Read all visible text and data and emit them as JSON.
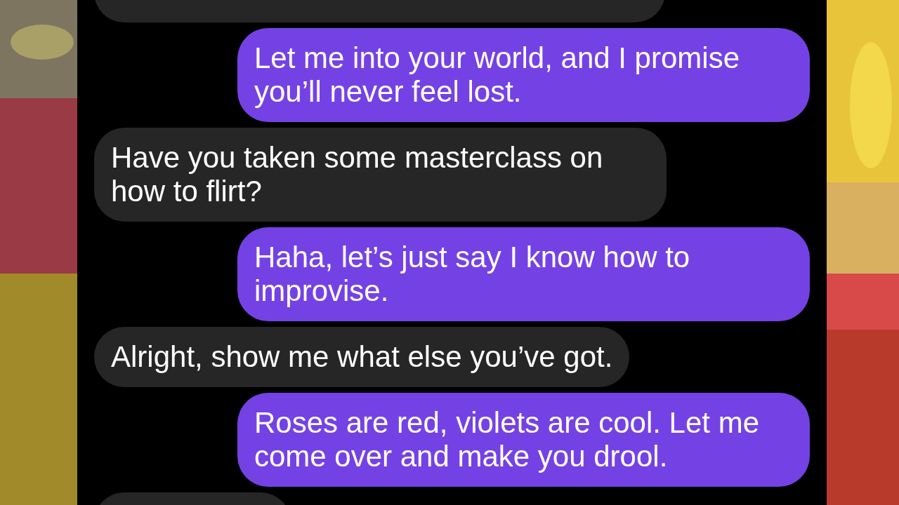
{
  "messages": [
    {
      "kind": "incoming"
    },
    {
      "kind": "outgoing",
      "text": "Let me into your world, and I promise you’ll never feel lost."
    },
    {
      "kind": "incoming",
      "text": "Have you taken some masterclass on how to flirt?"
    },
    {
      "kind": "outgoing",
      "text": "Haha, let’s just say I know how to improvise."
    },
    {
      "kind": "incoming",
      "text": "Alright, show me what else you’ve got."
    },
    {
      "kind": "outgoing",
      "text": "Roses are red, violets are cool. Let me come over and make you drool."
    },
    {
      "kind": "incoming"
    }
  ]
}
